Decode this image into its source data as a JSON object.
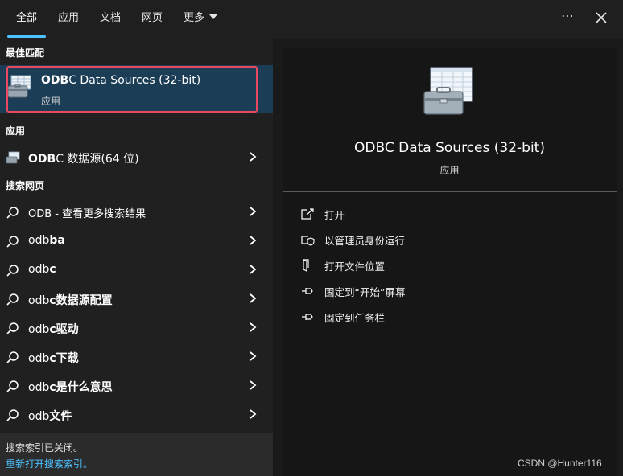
{
  "tabs": [
    {
      "label": "全部",
      "active": true
    },
    {
      "label": "应用"
    },
    {
      "label": "文档"
    },
    {
      "label": "网页"
    },
    {
      "label": "更多"
    }
  ],
  "top_icons": {
    "more": "ellipsis-icon",
    "close": "close-icon"
  },
  "left": {
    "best_match_label": "最佳匹配",
    "best_match": {
      "title_bold": "ODB",
      "title_rest": "C Data Sources (32-bit)",
      "subtitle": "应用",
      "icon": "odbc-toolbox-icon"
    },
    "apps_label": "应用",
    "apps": [
      {
        "bold": "ODB",
        "rest": "C 数据源(64 位)",
        "icon": "odbc-small-icon"
      }
    ],
    "web_label": "搜索网页",
    "web": [
      {
        "prefix": "ODB - 查看更多搜索结果",
        "bold": ""
      },
      {
        "prefix": "odb",
        "bold": "ba"
      },
      {
        "prefix": "odb",
        "bold": "c"
      },
      {
        "prefix": "odb",
        "bold": "c数据源配置"
      },
      {
        "prefix": "odb",
        "bold": "c驱动"
      },
      {
        "prefix": "odb",
        "bold": "c下载"
      },
      {
        "prefix": "odb",
        "bold": "c是什么意思"
      },
      {
        "prefix": "odb",
        "bold": "文件"
      }
    ],
    "note_line1": "搜索索引已关闭。",
    "note_line2": "重新打开搜索索引。"
  },
  "right": {
    "title": "ODBC Data Sources (32-bit)",
    "subtitle": "应用",
    "actions": [
      {
        "label": "打开",
        "icon": "open-external-icon"
      },
      {
        "label": "以管理员身份运行",
        "icon": "shield-icon"
      },
      {
        "label": "打开文件位置",
        "icon": "file-location-icon"
      },
      {
        "label": "固定到“开始”屏幕",
        "icon": "pin-icon"
      },
      {
        "label": "固定到任务栏",
        "icon": "pin-icon"
      }
    ]
  },
  "watermark": "CSDN @Hunter116",
  "colors": {
    "accent": "#4cc2ff",
    "selection": "#1c3d56",
    "highlight_border": "#e8495f"
  }
}
